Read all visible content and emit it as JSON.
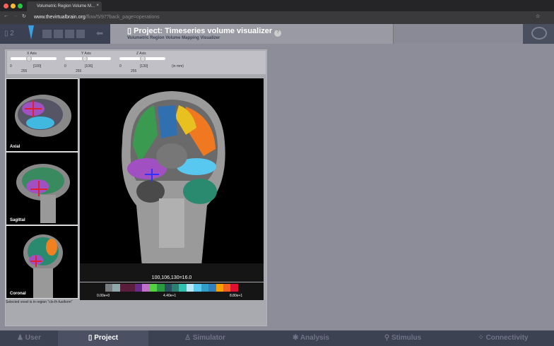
{
  "browser": {
    "tab_title": "Volumetric Region Volume M...",
    "url_host": "www.thevirtualbrain.org",
    "url_path": "/flow/5/97?back_page=operations"
  },
  "header": {
    "project_count": "2",
    "title": "Project: Timeseries volume visualizer",
    "subtitle": "Volumetric Region Volume Mapping Visualizer",
    "help": "?"
  },
  "sliders": [
    {
      "label": "X Axis",
      "min": "0",
      "max": "255",
      "value": "[100]",
      "fraction": 0.39
    },
    {
      "label": "Y Axis",
      "min": "0",
      "max": "255",
      "value": "[106]",
      "fraction": 0.42
    },
    {
      "label": "Z Axis",
      "min": "0",
      "max": "255",
      "value": "[130]",
      "fraction": 0.51
    }
  ],
  "units": "(in mm)",
  "views": {
    "axial": "Axial",
    "sagittal": "Sagittal",
    "coronal": "Coronal"
  },
  "readout": "100,106,130=16.0",
  "colorbar": {
    "min": "0.00e+0",
    "mid": "4.40e+1",
    "max": "8.80e+1",
    "colors": [
      "#777d80",
      "#8fa8aa",
      "#5a1e3c",
      "#5a1e3c",
      "#6a2a8a",
      "#c070c8",
      "#55d040",
      "#2a9a40",
      "#2a5060",
      "#2a8070",
      "#30c0b0",
      "#b8e8f8",
      "#58c8f0",
      "#30a0c8",
      "#3080c0",
      "#f8a000",
      "#f06020",
      "#e01030"
    ]
  },
  "status": "Selected voxel is in region \"ctx-lh-fusiform\"",
  "nav": [
    {
      "label": "User"
    },
    {
      "label": "Project"
    },
    {
      "label": "Simulator"
    },
    {
      "label": "Analysis"
    },
    {
      "label": "Stimulus"
    },
    {
      "label": "Connectivity"
    }
  ]
}
